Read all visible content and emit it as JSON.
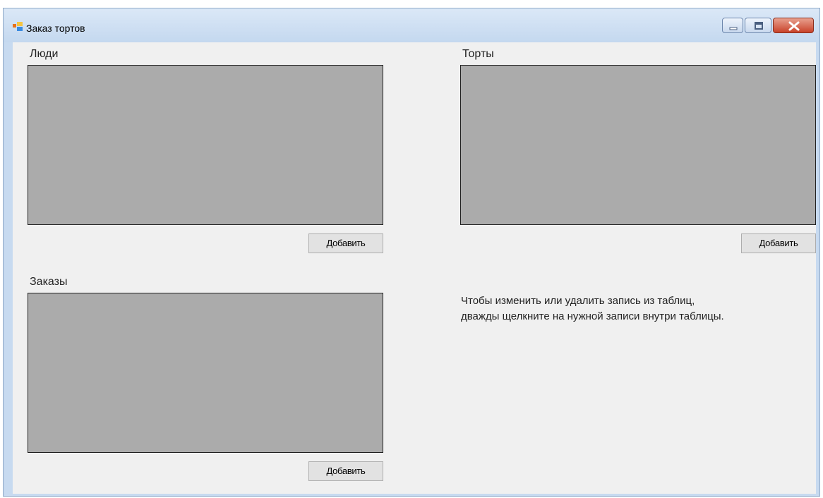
{
  "window": {
    "title": "Заказ тортов",
    "icons": {
      "app": "form-icon",
      "minimize": "minimize-icon",
      "maximize": "maximize-icon",
      "close": "close-icon"
    }
  },
  "people": {
    "label": "Люди",
    "add_label": "Добавить"
  },
  "cakes": {
    "label": "Торты",
    "add_label": "Добавить"
  },
  "orders": {
    "label": "Заказы",
    "add_label": "Добавить"
  },
  "info": {
    "line1": "Чтобы изменить или удалить запись из таблиц,",
    "line2": "дважды щелкните на нужной записи внутри таблицы."
  },
  "colors": {
    "grid_background": "#ababab",
    "form_background": "#f0f0f0",
    "close_button": "#c9432a"
  }
}
